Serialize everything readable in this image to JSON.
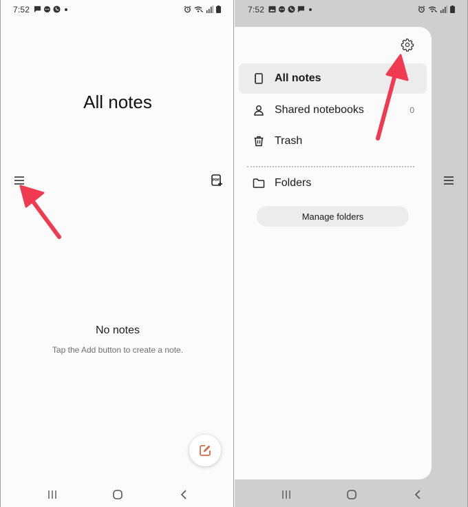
{
  "left": {
    "status": {
      "time": "7:52"
    },
    "page_title": "All notes",
    "empty_state": {
      "title": "No notes",
      "subtitle": "Tap the Add button to create a note."
    }
  },
  "right": {
    "status": {
      "time": "7:52"
    },
    "drawer": {
      "items": [
        {
          "label": "All notes",
          "icon": "notebook-icon",
          "active": true
        },
        {
          "label": "Shared notebooks",
          "icon": "person-icon",
          "count": "0"
        },
        {
          "label": "Trash",
          "icon": "trash-icon"
        },
        {
          "label": "Folders",
          "icon": "folder-icon"
        }
      ],
      "manage_folders_label": "Manage folders"
    }
  },
  "colors": {
    "annotation_arrow": "#f03a50",
    "fab_icon": "#d0694d",
    "active_item_bg": "#ececec"
  }
}
